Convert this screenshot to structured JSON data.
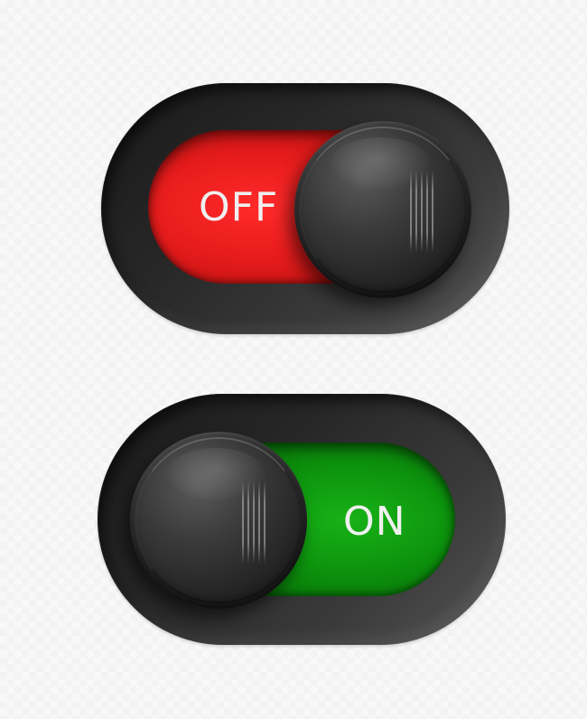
{
  "switches": [
    {
      "state_label": "OFF",
      "is_on": false,
      "track_color": "#e81c1c"
    },
    {
      "state_label": "ON",
      "is_on": true,
      "track_color": "#0d950d"
    }
  ],
  "icons": {
    "knob": "toggle-knob-icon",
    "grip": "grip-lines-icon"
  },
  "colors": {
    "housing": "#262626",
    "knob": "#2b2b2b",
    "label_text": "#f0f0f0",
    "background": "#f6f6f6"
  }
}
